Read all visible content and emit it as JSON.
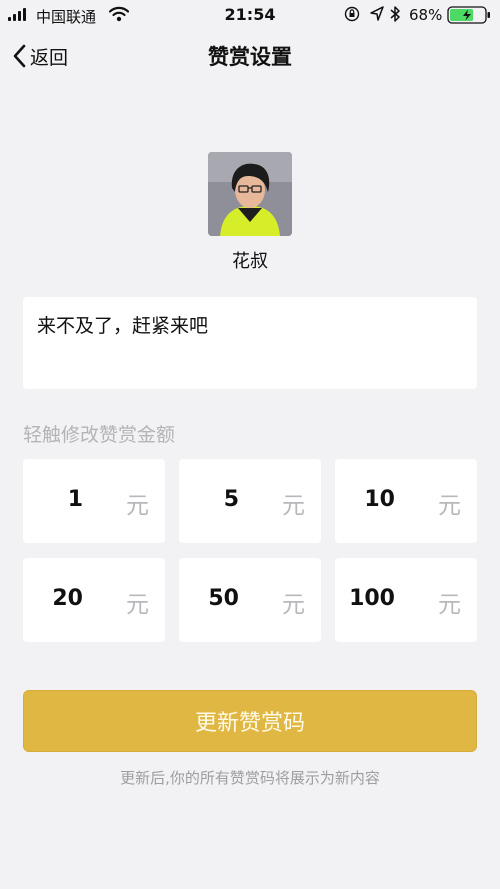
{
  "status_bar": {
    "carrier": "中国联通",
    "time": "21:54",
    "battery_percent": "68%",
    "battery_level": 0.68,
    "icons": [
      "signal-icon",
      "wifi-icon",
      "orientation-lock-icon",
      "location-icon",
      "bluetooth-icon",
      "battery-icon"
    ]
  },
  "nav": {
    "back_label": "返回",
    "title": "赞赏设置"
  },
  "profile": {
    "name": "花叔"
  },
  "message": {
    "text": "来不及了，赶紧来吧"
  },
  "amounts": {
    "hint": "轻触修改赞赏金额",
    "unit": "元",
    "values": [
      "1",
      "5",
      "10",
      "20",
      "50",
      "100"
    ]
  },
  "actions": {
    "update_label": "更新赞赏码",
    "note": "更新后,你的所有赞赏码将展示为新内容"
  },
  "colors": {
    "background": "#f2f2f4",
    "button": "#e1b744",
    "hint": "#b4b4b8"
  }
}
